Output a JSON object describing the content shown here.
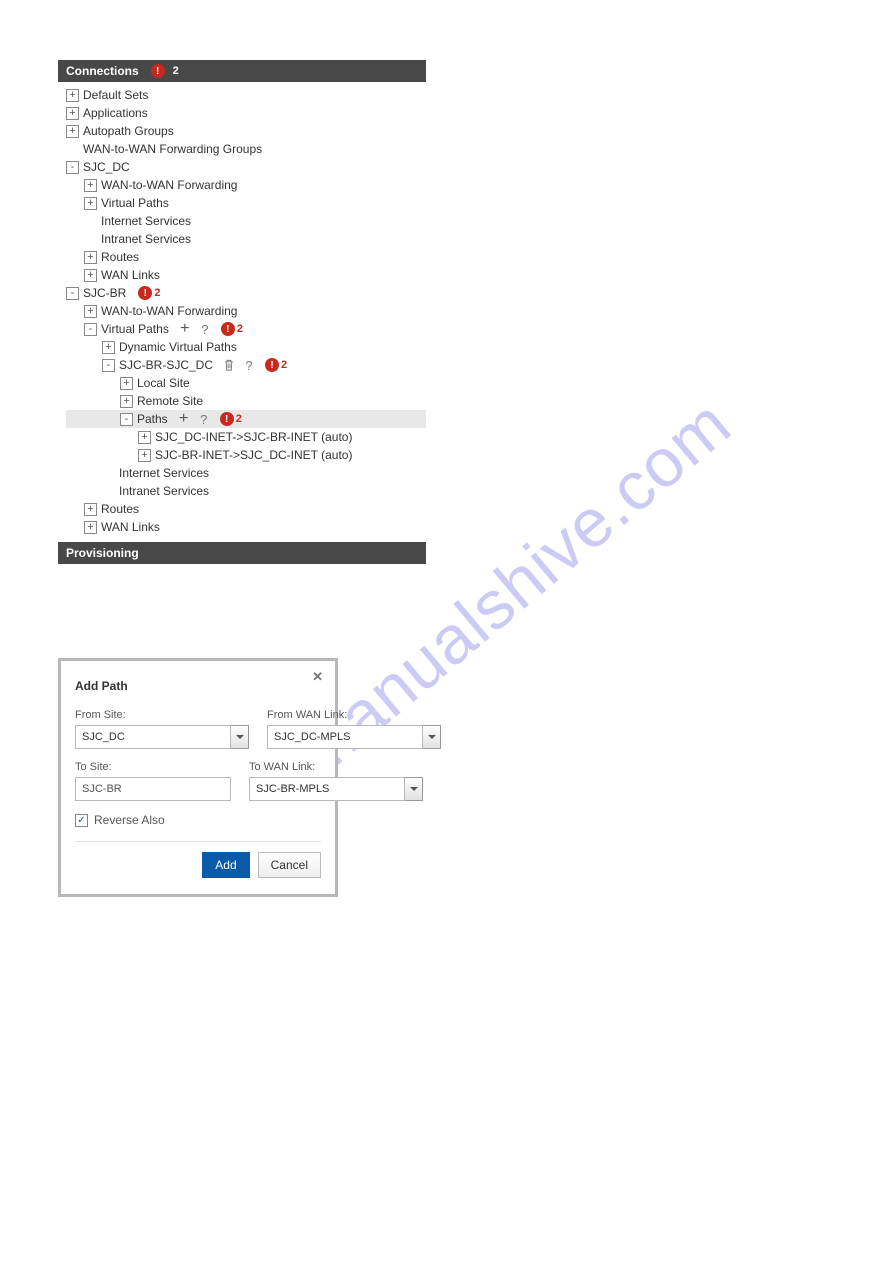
{
  "watermark_text": "manualshive.com",
  "connections_panel": {
    "title": "Connections",
    "error_count": "2",
    "tree": [
      {
        "id": "default-sets",
        "label": "Default Sets",
        "depth": 0,
        "expander": "+"
      },
      {
        "id": "applications",
        "label": "Applications",
        "depth": 0,
        "expander": "+"
      },
      {
        "id": "autopath-groups",
        "label": "Autopath Groups",
        "depth": 0,
        "expander": "+"
      },
      {
        "id": "wan2wan-fwd-groups",
        "label": "WAN-to-WAN Forwarding Groups",
        "depth": 0,
        "expander": ""
      },
      {
        "id": "sjc-dc",
        "label": "SJC_DC",
        "depth": 0,
        "expander": "-"
      },
      {
        "id": "sjc-dc-w2w",
        "label": "WAN-to-WAN Forwarding",
        "depth": 1,
        "expander": "+"
      },
      {
        "id": "sjc-dc-vpaths",
        "label": "Virtual Paths",
        "depth": 1,
        "expander": "+"
      },
      {
        "id": "sjc-dc-internet",
        "label": "Internet Services",
        "depth": 1,
        "expander": ""
      },
      {
        "id": "sjc-dc-intranet",
        "label": "Intranet Services",
        "depth": 1,
        "expander": ""
      },
      {
        "id": "sjc-dc-routes",
        "label": "Routes",
        "depth": 1,
        "expander": "+"
      },
      {
        "id": "sjc-dc-wanlinks",
        "label": "WAN Links",
        "depth": 1,
        "expander": "+"
      },
      {
        "id": "sjc-br",
        "label": "SJC-BR",
        "depth": 0,
        "expander": "-",
        "errBadge": "!",
        "errCount": "2"
      },
      {
        "id": "sjc-br-w2w",
        "label": "WAN-to-WAN Forwarding",
        "depth": 1,
        "expander": "+"
      },
      {
        "id": "sjc-br-vpaths",
        "label": "Virtual Paths",
        "depth": 1,
        "expander": "-",
        "actions": [
          "add",
          "help"
        ],
        "errBadge": "!",
        "errCount": "2"
      },
      {
        "id": "dyn-vpaths",
        "label": "Dynamic Virtual Paths",
        "depth": 2,
        "expander": "+"
      },
      {
        "id": "sjc-br-sjc-dc",
        "label": "SJC-BR-SJC_DC",
        "depth": 2,
        "expander": "-",
        "actions": [
          "trash",
          "help"
        ],
        "errBadge": "!",
        "errCount": "2"
      },
      {
        "id": "local-site",
        "label": "Local Site",
        "depth": 3,
        "expander": "+"
      },
      {
        "id": "remote-site",
        "label": "Remote Site",
        "depth": 3,
        "expander": "+"
      },
      {
        "id": "paths",
        "label": "Paths",
        "depth": 3,
        "expander": "-",
        "selected": true,
        "actions": [
          "add",
          "help"
        ],
        "errBadge": "!",
        "errCount": "2"
      },
      {
        "id": "path1",
        "label": "SJC_DC-INET->SJC-BR-INET (auto)",
        "depth": 4,
        "expander": "+"
      },
      {
        "id": "path2",
        "label": "SJC-BR-INET->SJC_DC-INET (auto)",
        "depth": 4,
        "expander": "+"
      },
      {
        "id": "sjc-br-internet",
        "label": "Internet Services",
        "depth": 2,
        "expander": ""
      },
      {
        "id": "sjc-br-intranet",
        "label": "Intranet Services",
        "depth": 2,
        "expander": ""
      },
      {
        "id": "sjc-br-routes",
        "label": "Routes",
        "depth": 1,
        "expander": "+"
      },
      {
        "id": "sjc-br-wanlinks",
        "label": "WAN Links",
        "depth": 1,
        "expander": "+"
      }
    ]
  },
  "provisioning_panel": {
    "title": "Provisioning"
  },
  "dialog": {
    "title": "Add Path",
    "from_site_label": "From Site:",
    "from_site_value": "SJC_DC",
    "from_wan_label": "From WAN Link:",
    "from_wan_value": "SJC_DC-MPLS",
    "to_site_label": "To Site:",
    "to_site_value": "SJC-BR",
    "to_wan_label": "To WAN Link:",
    "to_wan_value": "SJC-BR-MPLS",
    "reverse_label": "Reverse Also",
    "reverse_checked": true,
    "add_btn": "Add",
    "cancel_btn": "Cancel"
  }
}
